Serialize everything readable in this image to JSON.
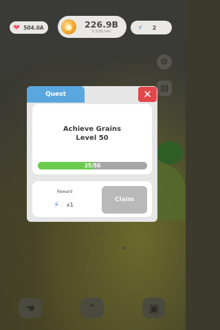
{
  "hud": {
    "hearts": "504.0A",
    "coins": "226.9B",
    "coin_rate": "3.32B /sec",
    "energy": "2"
  },
  "icons": {
    "heart": "heart-icon",
    "coin": "coin-icon",
    "bolt": "lightning-icon",
    "gear": "gear-icon",
    "clipboard": "clipboard-icon",
    "close": "close-icon",
    "nav_left": "hand-icon",
    "nav_center": "chevrons-up-icon",
    "nav_right": "shop-bag-icon"
  },
  "modal": {
    "tab_label": "Quest",
    "close_symbol": "✕",
    "task_line1": "Achieve Grains",
    "task_line2": "Level 50",
    "progress_text": "25/50",
    "progress_fraction": 0.5,
    "reward_label": "Reward",
    "reward_qty": "x1",
    "claim_label": "Claim"
  },
  "colors": {
    "tab": "#5aa7e0",
    "close": "#e2474c",
    "progress_fill": "#6bcb4e",
    "progress_track": "#a6a6a6",
    "claim_disabled": "#b9b9b9"
  }
}
